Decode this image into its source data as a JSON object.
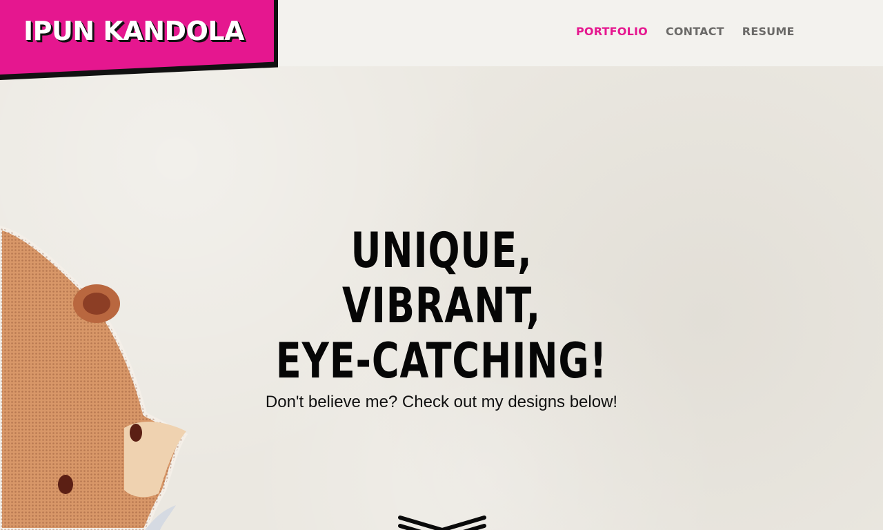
{
  "brand": {
    "name": "IPUN KANDOLA",
    "accent": "#e5178f",
    "ink": "#111111"
  },
  "nav": {
    "items": [
      {
        "label": "PORTFOLIO",
        "active": true
      },
      {
        "label": "CONTACT",
        "active": false
      },
      {
        "label": "RESUME",
        "active": false
      }
    ]
  },
  "hero": {
    "lines": [
      "UNIQUE,",
      "VIBRANT,",
      "EYE-CATCHING!"
    ],
    "subtitle": "Don't believe me? Check out my designs below!"
  },
  "icons": {
    "scroll": "chevron-down-icon",
    "illustration": "hamster-illustration"
  }
}
